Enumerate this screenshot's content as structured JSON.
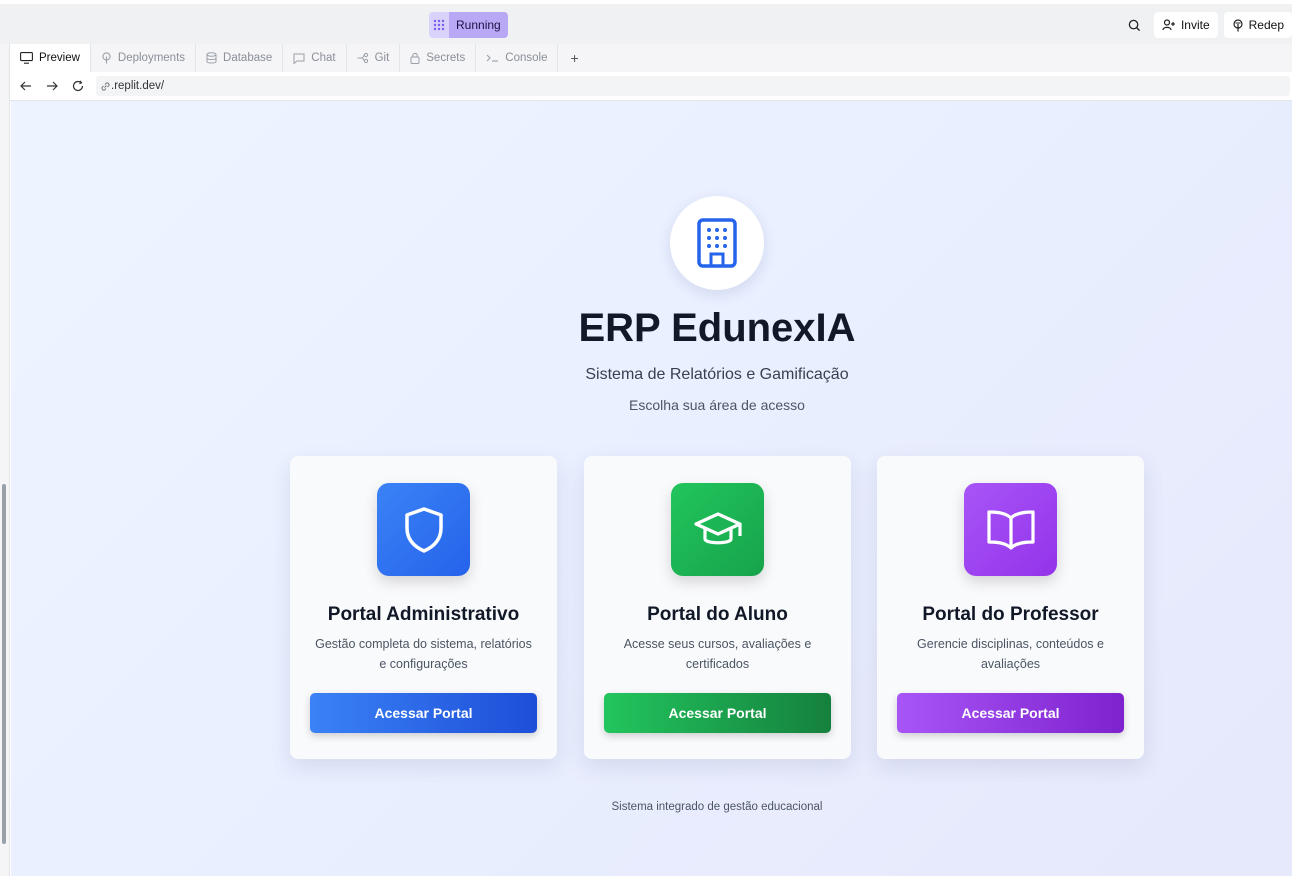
{
  "topbar": {
    "status_label": "Running",
    "invite_label": "Invite",
    "redeploy_label": "Redep"
  },
  "tabs": [
    {
      "label": "Preview",
      "icon": "monitor-icon"
    },
    {
      "label": "Deployments",
      "icon": "deploy-icon"
    },
    {
      "label": "Database",
      "icon": "database-icon"
    },
    {
      "label": "Chat",
      "icon": "chat-icon"
    },
    {
      "label": "Git",
      "icon": "git-icon"
    },
    {
      "label": "Secrets",
      "icon": "lock-icon"
    },
    {
      "label": "Console",
      "icon": "terminal-icon"
    }
  ],
  "urlbar": {
    "url": ".replit.dev/"
  },
  "page": {
    "title": "ERP EdunexIA",
    "subtitle": "Sistema de Relatórios e Gamificação",
    "hint": "Escolha sua área de acesso",
    "footer": "Sistema integrado de gestão educacional"
  },
  "cards": [
    {
      "title": "Portal Administrativo",
      "desc": "Gestão completa do sistema, relatórios e configurações",
      "button": "Acessar Portal",
      "icon": "shield-icon",
      "color_from": "#3b82f6",
      "color_to": "#1d4ed8"
    },
    {
      "title": "Portal do Aluno",
      "desc": "Acesse seus cursos, avaliações e certificados",
      "button": "Acessar Portal",
      "icon": "graduation-cap-icon",
      "color_from": "#22c55e",
      "color_to": "#15803d"
    },
    {
      "title": "Portal do Professor",
      "desc": "Gerencie disciplinas, conteúdos e avaliações",
      "button": "Acessar Portal",
      "icon": "book-open-icon",
      "color_from": "#a855f7",
      "color_to": "#7e22ce"
    }
  ]
}
